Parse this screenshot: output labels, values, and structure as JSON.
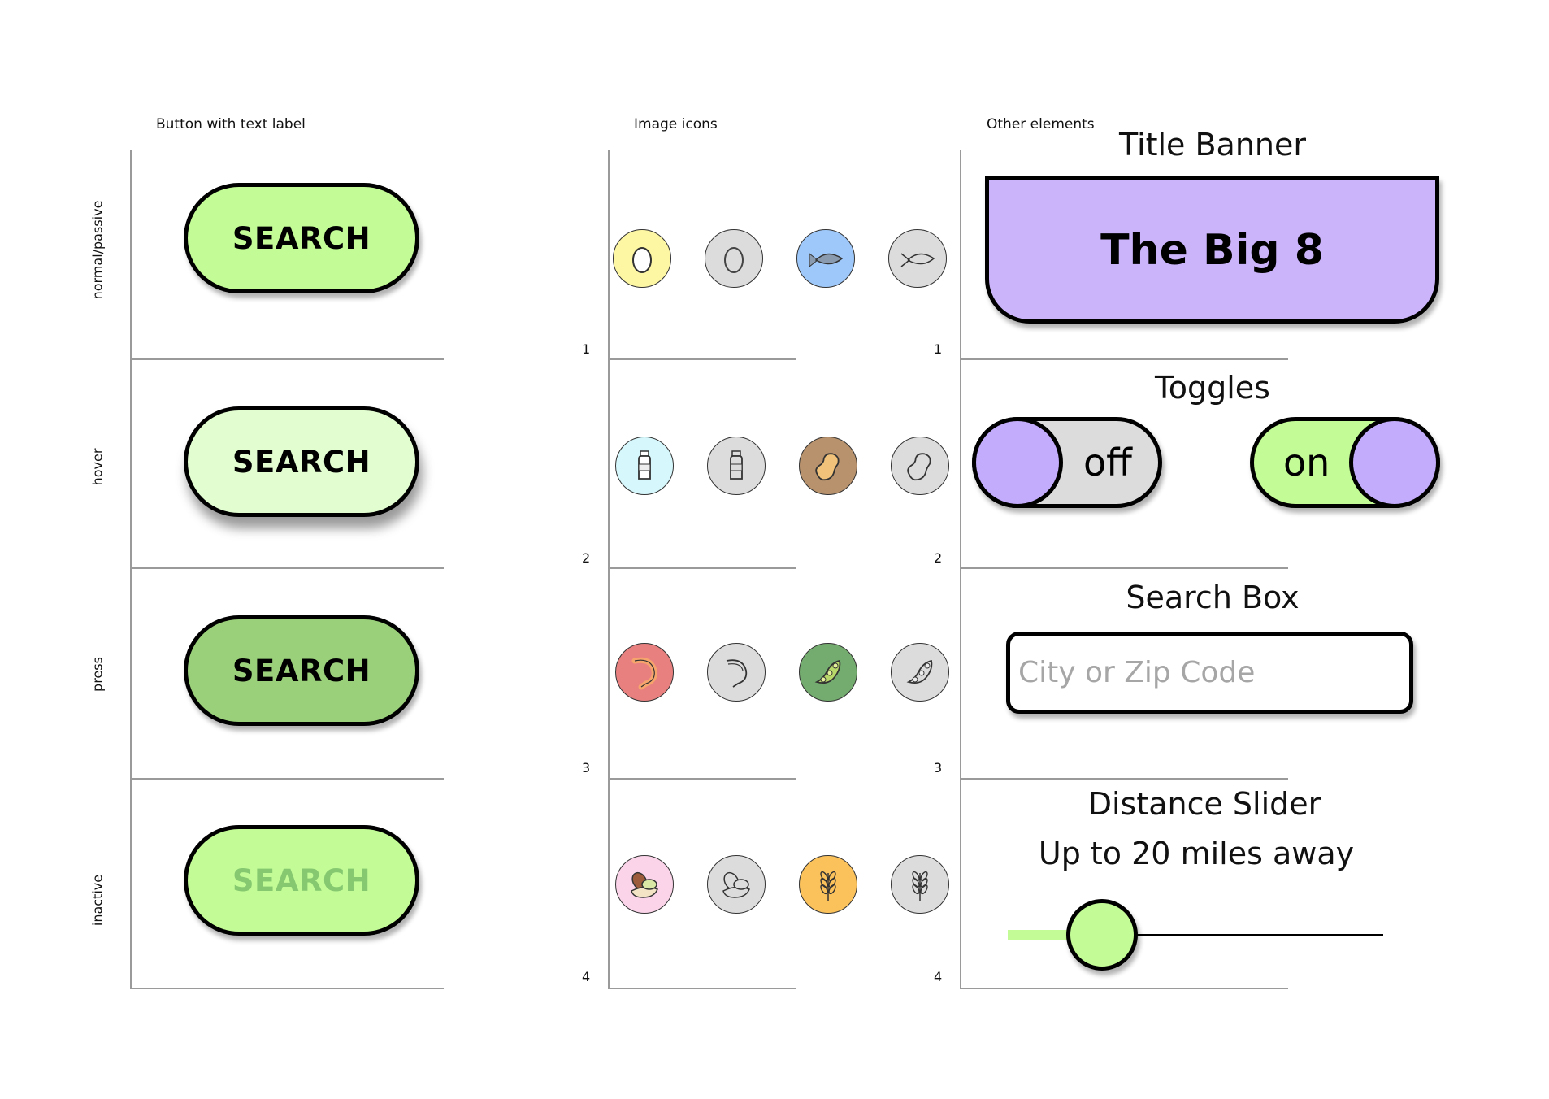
{
  "columns": {
    "buttons_header": "Button with text label",
    "icons_header": "Image icons",
    "other_header": "Other elements"
  },
  "row_labels": [
    "normal/passive",
    "hover",
    "press",
    "inactive"
  ],
  "row_numbers": [
    "1",
    "2",
    "3",
    "4"
  ],
  "buttons": [
    {
      "state": "normal",
      "label": "SEARCH"
    },
    {
      "state": "hover",
      "label": "SEARCH"
    },
    {
      "state": "press",
      "label": "SEARCH"
    },
    {
      "state": "inactive",
      "label": "SEARCH"
    }
  ],
  "icons": [
    [
      {
        "name": "egg-color-icon",
        "color": "#fdf6a3"
      },
      {
        "name": "egg-gray-icon",
        "color": "#dcdcdc"
      },
      {
        "name": "fish-color-icon",
        "color": "#9ec8f9"
      },
      {
        "name": "fish-gray-icon",
        "color": "#dcdcdc"
      }
    ],
    [
      {
        "name": "milk-color-icon",
        "color": "#d6f8fc"
      },
      {
        "name": "milk-gray-icon",
        "color": "#dcdcdc"
      },
      {
        "name": "peanut-color-icon",
        "color": "#b8926d"
      },
      {
        "name": "peanut-gray-icon",
        "color": "#dcdcdc"
      }
    ],
    [
      {
        "name": "shrimp-color-icon",
        "color": "#e98080"
      },
      {
        "name": "shrimp-gray-icon",
        "color": "#dcdcdc"
      },
      {
        "name": "soybean-color-icon",
        "color": "#74ab6e"
      },
      {
        "name": "soybean-gray-icon",
        "color": "#dcdcdc"
      }
    ],
    [
      {
        "name": "tree-nut-color-icon",
        "color": "#fbd4ea"
      },
      {
        "name": "tree-nut-gray-icon",
        "color": "#dcdcdc"
      },
      {
        "name": "wheat-color-icon",
        "color": "#fbc25c"
      },
      {
        "name": "wheat-gray-icon",
        "color": "#dcdcdc"
      }
    ]
  ],
  "other": {
    "banner_section_title": "Title Banner",
    "banner_text": "The Big 8",
    "toggles_section_title": "Toggles",
    "toggle_off_label": "off",
    "toggle_on_label": "on",
    "search_section_title": "Search Box",
    "search_placeholder": "City or Zip Code",
    "slider_section_title": "Distance Slider",
    "slider_caption": "Up to 20 miles away",
    "slider_value_fraction": 0.25
  },
  "colors": {
    "green": "#c3fb96",
    "green_hover": "#e2fdd0",
    "green_press": "#9bd07b",
    "purple": "#ccb4fb",
    "knob_purple": "#c3acfb",
    "toggle_off_bg": "#dcdcdc"
  }
}
